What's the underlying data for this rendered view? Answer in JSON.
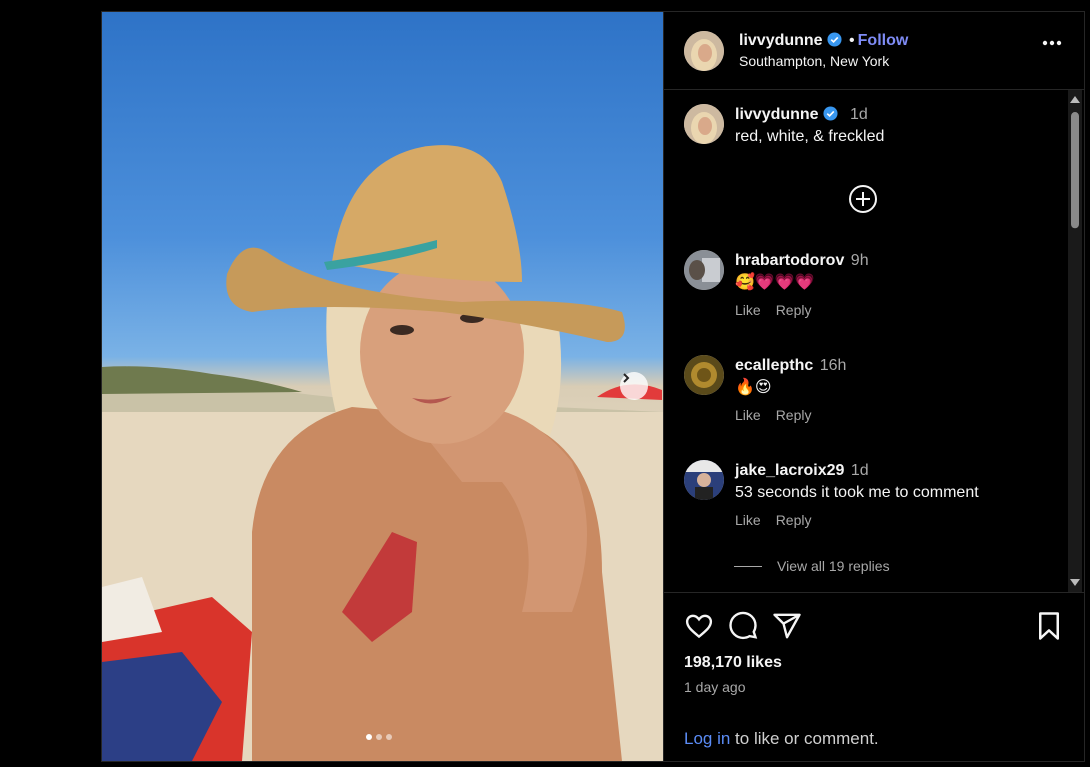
{
  "post": {
    "author": "livvydunne",
    "follow_label": "Follow",
    "separator": "•",
    "location": "Southampton, New York",
    "likes": "198,170 likes",
    "time_ago": "1 day ago",
    "login_link": "Log in",
    "login_suffix": " to like or comment.",
    "carousel": {
      "slide_count": 3,
      "active_index": 1
    }
  },
  "caption": {
    "username": "livvydunne",
    "time": "1d",
    "text": "red, white, & freckled"
  },
  "comments": [
    {
      "username": "hrabartodorov",
      "time": "9h",
      "text": "🥰💗💗💗",
      "like_label": "Like",
      "reply_label": "Reply"
    },
    {
      "username": "ecallepthc",
      "time": "16h",
      "text": "🔥😍",
      "like_label": "Like",
      "reply_label": "Reply"
    },
    {
      "username": "jake_lacroix29",
      "time": "1d",
      "text": "53 seconds it took me to comment",
      "like_label": "Like",
      "reply_label": "Reply"
    }
  ],
  "view_replies": "View all 19 replies",
  "colors": {
    "accent": "#7f8cf6",
    "link": "#5b8cf6",
    "verified": "#3897f0",
    "background": "#000000"
  }
}
